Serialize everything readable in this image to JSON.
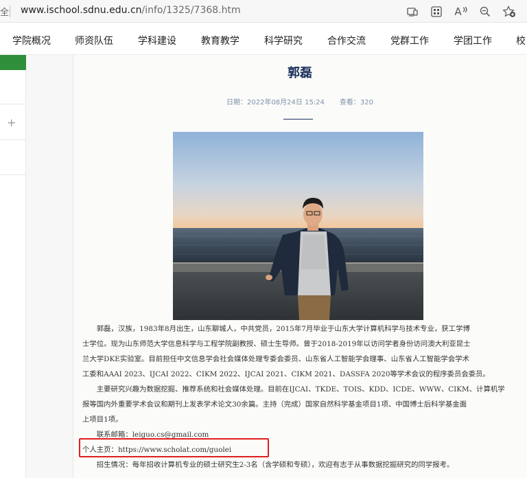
{
  "browser": {
    "lead_char": "全",
    "url_host": "www.ischool.sdnu.edu.cn",
    "url_path": "/info/1325/7368.htm",
    "read_aloud_label": "A"
  },
  "nav": {
    "items": [
      {
        "label": "学院概况"
      },
      {
        "label": "师资队伍"
      },
      {
        "label": "学科建设"
      },
      {
        "label": "教育教学"
      },
      {
        "label": "科学研究"
      },
      {
        "label": "合作交流"
      },
      {
        "label": "党群工作"
      },
      {
        "label": "学团工作"
      },
      {
        "label": "校"
      }
    ]
  },
  "sidebar": {
    "plus_label": "+"
  },
  "article": {
    "title": "郭磊",
    "date": "日期：2022年08月24日 15:24",
    "views": "查看：320",
    "lines": [
      "　　郭磊，汉族，1983年8月出生，山东聊城人，中共党员，2015年7月毕业于山东大学计算机科学与技术专业，获工学博",
      "士学位。现为山东师范大学信息科学与工程学院副教授、硕士生导师。曾于2018-2019年以访问学者身份访问澳大利亚昆士",
      "兰大学DKE实验室。目前担任中文信息学会社会媒体处理专委会委员、山东省人工智能学会理事、山东省人工智能学会学术",
      "工委和AAAI 2023、IJCAI 2022、CIKM 2022、IJCAI 2021、CIKM 2021、DASSFA 2020等学术会议的程序委员会委员。",
      "　　主要研究兴趣为数据挖掘、推荐系统和社会媒体处理。目前在IJCAI、TKDE、TOIS、KDD、ICDE、WWW、CIKM、计算机学",
      "报等国内外重要学术会议和期刊上发表学术论文30余篇。主持（完成）国家自然科学基金项目1项、中国博士后科学基金面",
      "上项目1项。",
      "　　联系邮箱：leiguo.cs@gmail.com",
      "个人主页：https://www.scholat.com/guolei",
      "　　招生情况：每年招收计算机专业的硕士研究生2-3名（含学硕和专硕），欢迎有志于从事数据挖掘研究的同学报考。"
    ]
  },
  "colors": {
    "title": "#1a2f5a",
    "meta": "#7f90a8",
    "green_accent": "#2f8f3a",
    "highlight_red": "#e01d1d"
  },
  "icons": [
    "reader-mode-icon",
    "apps-grid-icon",
    "read-aloud-icon",
    "zoom-out-icon",
    "favorites-add-icon"
  ]
}
